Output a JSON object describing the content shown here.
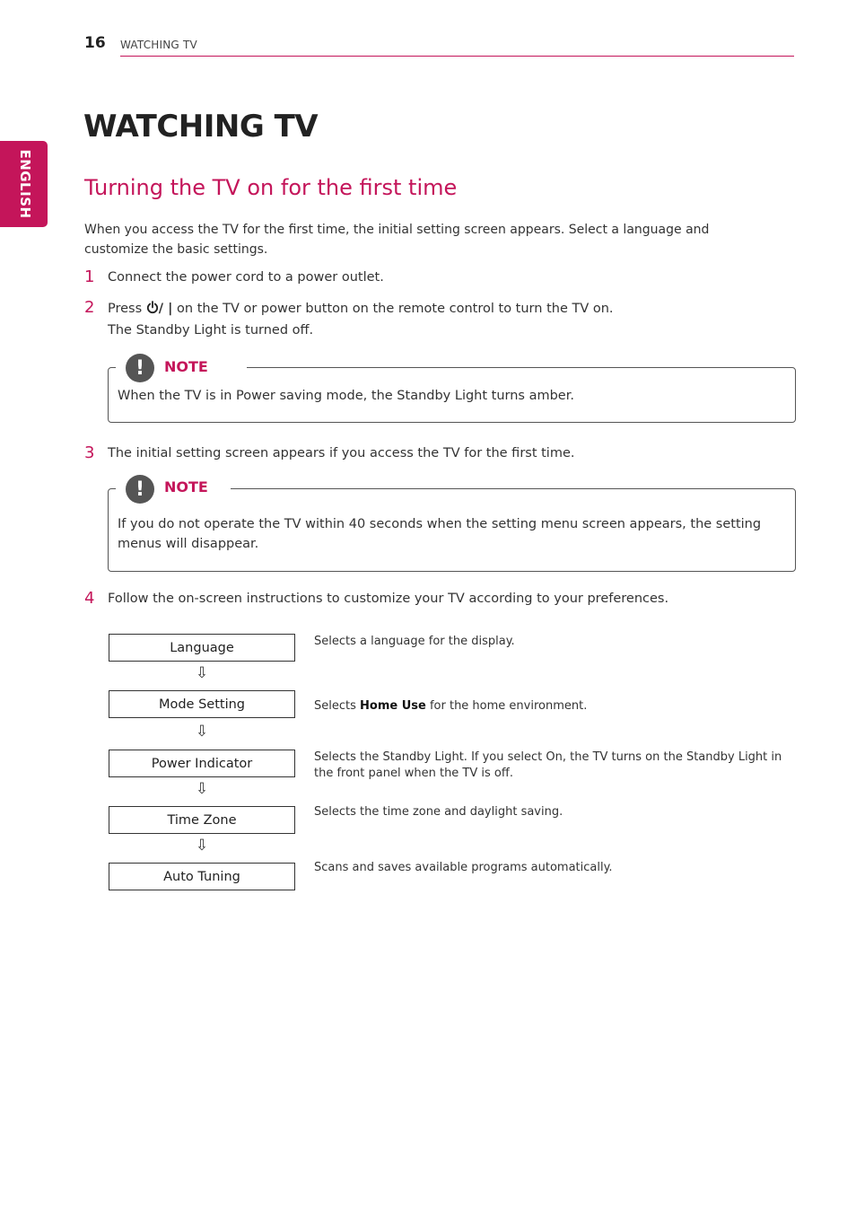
{
  "header": {
    "page_number": "16",
    "section": "WATCHING TV"
  },
  "side_tab": {
    "label": "ENGLISH"
  },
  "page_title": "WATCHING TV",
  "section_title": "Turning the TV on for the first time",
  "intro": "When you access the TV for the first time, the initial setting screen appears. Select a language and customize the basic settings.",
  "steps": [
    {
      "number": "1",
      "text": "Connect the power cord to a power outlet."
    },
    {
      "number": "2",
      "text_before": "Press",
      "power_symbol": "/ |",
      "text_after": "on the TV or power button on the remote control to turn the TV on.",
      "line2": "The Standby Light is turned off."
    },
    {
      "number": "3",
      "text": "The initial setting screen appears if you access the TV for the first time."
    },
    {
      "number": "4",
      "text": "Follow the on-screen instructions to customize your TV according to your preferences."
    }
  ],
  "notes": [
    {
      "label": "NOTE",
      "icon": "exclamation-icon",
      "text": "When the TV is in Power saving mode, the Standby Light turns amber."
    },
    {
      "label": "NOTE",
      "icon": "exclamation-icon",
      "text": "If you do not operate the TV within 40 seconds when the setting menu screen appears, the setting menus will disappear."
    }
  ],
  "flow": {
    "arrow": "⇩",
    "items": [
      {
        "label": "Language",
        "desc": "Selects a language for the display."
      },
      {
        "label": "Mode Setting",
        "desc_before": "Selects ",
        "desc_bold": "Home Use",
        "desc_after": " for the home environment."
      },
      {
        "label": "Power Indicator",
        "desc": "Selects the Standby Light. If you select On, the TV turns on the Standby Light in the front panel when the TV is off."
      },
      {
        "label": "Time Zone",
        "desc": "Selects the time zone and daylight saving."
      },
      {
        "label": "Auto Tuning",
        "desc": "Scans and saves available programs automatically."
      }
    ]
  },
  "colors": {
    "accent": "#c4155a",
    "text": "#333333",
    "note_icon": "#555555"
  }
}
